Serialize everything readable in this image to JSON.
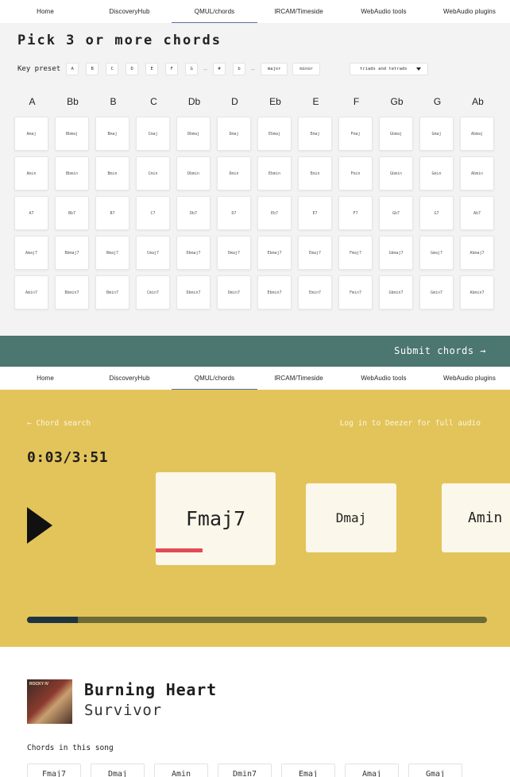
{
  "nav": {
    "items": [
      {
        "label": "Home",
        "active": false
      },
      {
        "label": "DiscoveryHub",
        "active": false
      },
      {
        "label": "QMUL/chords",
        "active": true
      },
      {
        "label": "IRCAM/Timeside",
        "active": false
      },
      {
        "label": "WebAudio tools",
        "active": false
      },
      {
        "label": "WebAudio plugins",
        "active": false
      }
    ]
  },
  "picker": {
    "title": "Pick 3 or more chords",
    "preset_label": "Key preset",
    "keys": [
      "A",
      "B",
      "C",
      "D",
      "E",
      "F",
      "G"
    ],
    "accidentals": [
      "#",
      "b"
    ],
    "modes": [
      "major",
      "minor"
    ],
    "dash": "—",
    "select_value": "triads and tetrads",
    "roots": [
      "A",
      "Bb",
      "B",
      "C",
      "Db",
      "D",
      "Eb",
      "E",
      "F",
      "Gb",
      "G",
      "Ab"
    ],
    "rows": [
      [
        "Amaj",
        "Bbmaj",
        "Bmaj",
        "Cmaj",
        "Dbmaj",
        "Dmaj",
        "Ebmaj",
        "Emaj",
        "Fmaj",
        "Gbmaj",
        "Gmaj",
        "Abmaj"
      ],
      [
        "Amin",
        "Bbmin",
        "Bmin",
        "Cmin",
        "Dbmin",
        "Dmin",
        "Ebmin",
        "Emin",
        "Fmin",
        "Gbmin",
        "Gmin",
        "Abmin"
      ],
      [
        "A7",
        "Bb7",
        "B7",
        "C7",
        "Db7",
        "D7",
        "Eb7",
        "E7",
        "F7",
        "Gb7",
        "G7",
        "Ab7"
      ],
      [
        "Amaj7",
        "Bbmaj7",
        "Bmaj7",
        "Cmaj7",
        "Dbmaj7",
        "Dmaj7",
        "Ebmaj7",
        "Emaj7",
        "Fmaj7",
        "Gbmaj7",
        "Gmaj7",
        "Abmaj7"
      ],
      [
        "Amin7",
        "Bbmin7",
        "Bmin7",
        "Cmin7",
        "Dbmin7",
        "Dmin7",
        "Ebmin7",
        "Emin7",
        "Fmin7",
        "Gbmin7",
        "Gmin7",
        "Abmin7"
      ]
    ],
    "submit_label": "Submit chords →"
  },
  "player": {
    "back_label": "← Chord search",
    "login_label": "Log in to Deezer for full audio",
    "time": "0:03/3:51",
    "current_chord": "Fmaj7",
    "next_chord": "Dmaj",
    "next_chord_2": "Amin",
    "chord_progress": 0.39,
    "track_progress": 0.11
  },
  "song": {
    "album_tag": "ROCKY IV",
    "title": "Burning Heart",
    "artist": "Survivor",
    "chords_label": "Chords in this song",
    "chords": [
      "Fmaj7",
      "Dmaj",
      "Amin",
      "Dmin7",
      "Emaj",
      "Amaj",
      "Gmaj"
    ]
  },
  "colors": {
    "picker_bg": "#f3f3f3",
    "submit_bar": "#4c7670",
    "player_bg": "#e3c45a",
    "card_bg": "#fbf7ea",
    "chord_progress": "#e24b55",
    "track_fill": "#1e3440",
    "track_bg": "#6d6a36"
  }
}
